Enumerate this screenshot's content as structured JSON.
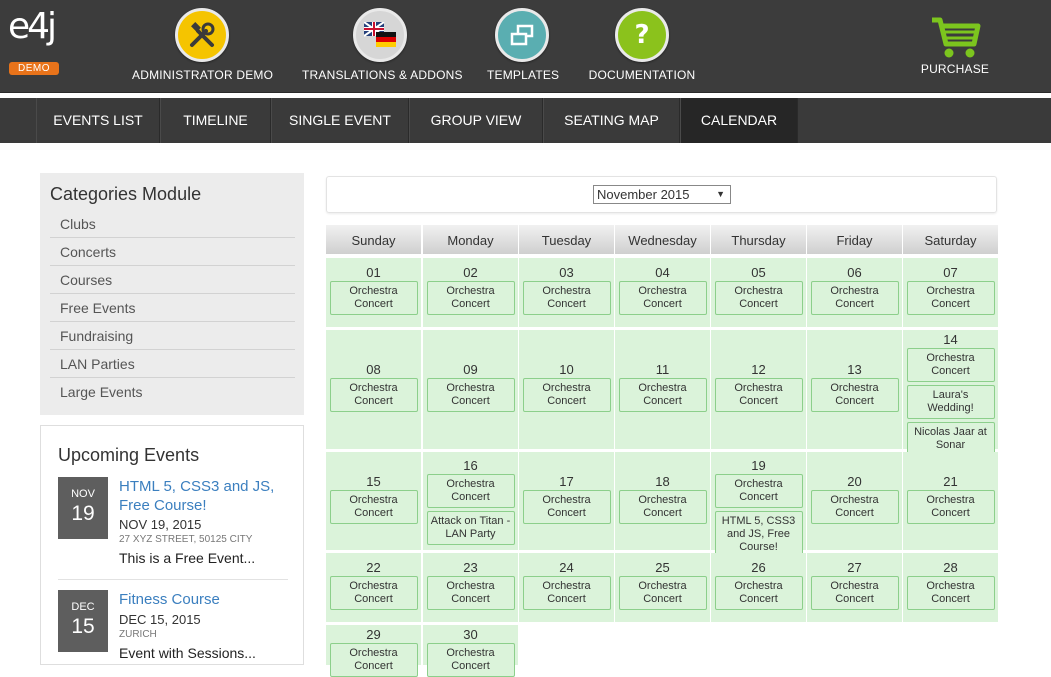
{
  "brand": {
    "logo_text": "e4j",
    "badge": "DEMO"
  },
  "topnav": [
    {
      "label": "ADMINISTRATOR DEMO",
      "icon": "tools-icon",
      "color": "#f5c400"
    },
    {
      "label": "TRANSLATIONS & ADDONS",
      "icon": "flags-icon",
      "color": "#d6d6d6"
    },
    {
      "label": "TEMPLATES",
      "icon": "windows-icon",
      "color": "#5aaeb1"
    },
    {
      "label": "DOCUMENTATION",
      "icon": "question-icon",
      "color": "#8bc21c"
    },
    {
      "label": "PURCHASE",
      "icon": "cart-icon",
      "color": "#7cc51e"
    }
  ],
  "tabs": [
    "EVENTS LIST",
    "TIMELINE",
    "SINGLE EVENT",
    "GROUP VIEW",
    "SEATING MAP",
    "CALENDAR"
  ],
  "active_tab": "CALENDAR",
  "categories": {
    "title": "Categories Module",
    "items": [
      "Clubs",
      "Concerts",
      "Courses",
      "Free Events",
      "Fundraising",
      "LAN Parties",
      "Large Events"
    ]
  },
  "upcoming": {
    "title": "Upcoming Events",
    "events": [
      {
        "month": "NOV",
        "day": "19",
        "title": "HTML 5, CSS3 and JS, Free Course!",
        "date": "NOV 19, 2015",
        "location": "27 XYZ STREET, 50125 CITY",
        "desc": "This is a Free Event..."
      },
      {
        "month": "DEC",
        "day": "15",
        "title": "Fitness Course",
        "date": "DEC 15, 2015",
        "location": "ZURICH",
        "desc": "Event with Sessions..."
      }
    ]
  },
  "calendar": {
    "selected_month": "November 2015",
    "weekdays": [
      "Sunday",
      "Monday",
      "Tuesday",
      "Wednesday",
      "Thursday",
      "Friday",
      "Saturday"
    ],
    "default_event": "Orchestra Concert",
    "extra_events": {
      "14": [
        "Laura's Wedding!",
        "Nicolas Jaar at Sonar"
      ],
      "16": [
        "Attack on Titan - LAN Party"
      ],
      "19": [
        "HTML 5, CSS3 and JS, Free Course!"
      ]
    },
    "days": [
      "01",
      "02",
      "03",
      "04",
      "05",
      "06",
      "07",
      "08",
      "09",
      "10",
      "11",
      "12",
      "13",
      "14",
      "15",
      "16",
      "17",
      "18",
      "19",
      "20",
      "21",
      "22",
      "23",
      "24",
      "25",
      "26",
      "27",
      "28",
      "29",
      "30"
    ]
  }
}
